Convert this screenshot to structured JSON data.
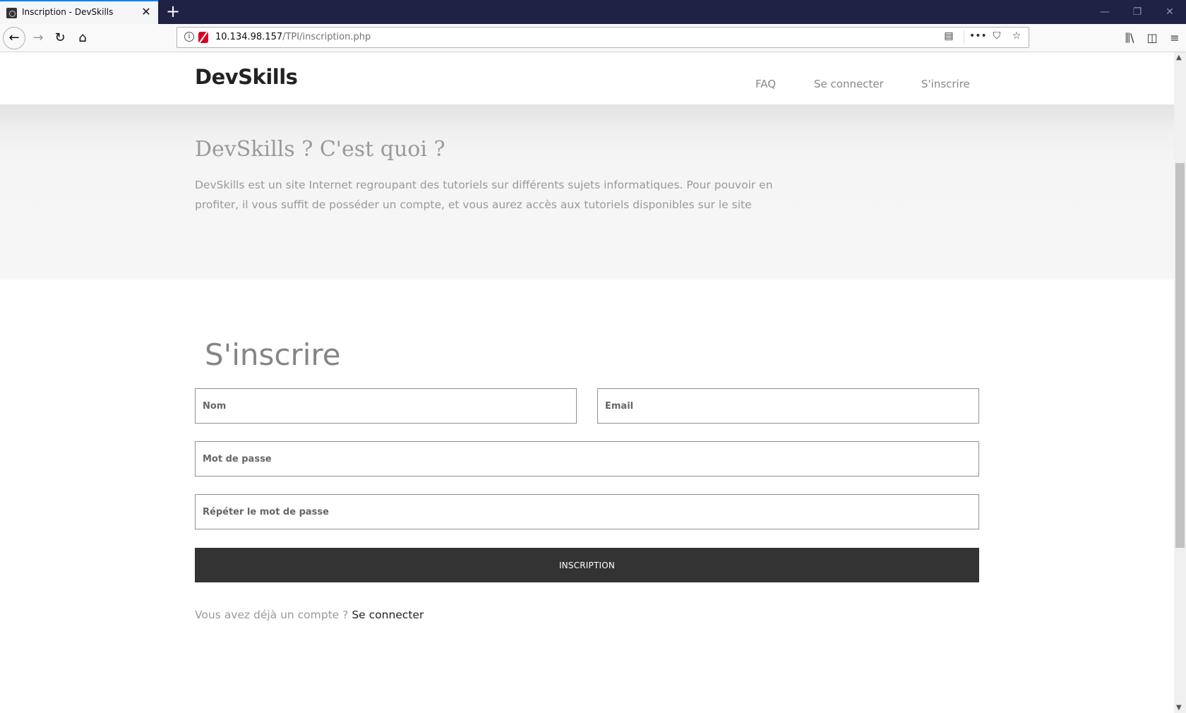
{
  "browser": {
    "tab_title": "Inscription - DevSkills",
    "tab_close": "✕",
    "new_tab": "+",
    "url_host": "10.134.98.157",
    "url_path": "/TPI/inscription.php",
    "controls": {
      "minimize": "—",
      "restore": "❐",
      "close": "✕"
    },
    "nav": {
      "back": "←",
      "forward": "→",
      "reload": "↻",
      "home": "⌂"
    },
    "url_actions": {
      "reader": "▤",
      "more": "•••",
      "pocket": "⛉",
      "bookmark": "☆"
    },
    "right_tools": {
      "library": "⫼\\",
      "sidebar": "◫",
      "menu": "≡"
    }
  },
  "site": {
    "brand": "DevSkills",
    "nav": [
      "FAQ",
      "Se connecter",
      "S'inscrire"
    ]
  },
  "hero": {
    "title": "DevSkills ? C'est quoi ?",
    "text": "DevSkills est un site Internet regroupant des tutoriels sur différents sujets informatiques. Pour pouvoir en profiter, il vous suffit de posséder un compte, et vous aurez accès aux tutoriels disponibles sur le site"
  },
  "form": {
    "title": "S'inscrire",
    "nom_placeholder": "Nom",
    "email_placeholder": "Email",
    "pass_placeholder": "Mot de passe",
    "pass2_placeholder": "Répéter le mot de passe",
    "submit_label": "INSCRIPTION",
    "already_text": "Vous avez déjà un compte ? ",
    "login_link": "Se connecter"
  }
}
